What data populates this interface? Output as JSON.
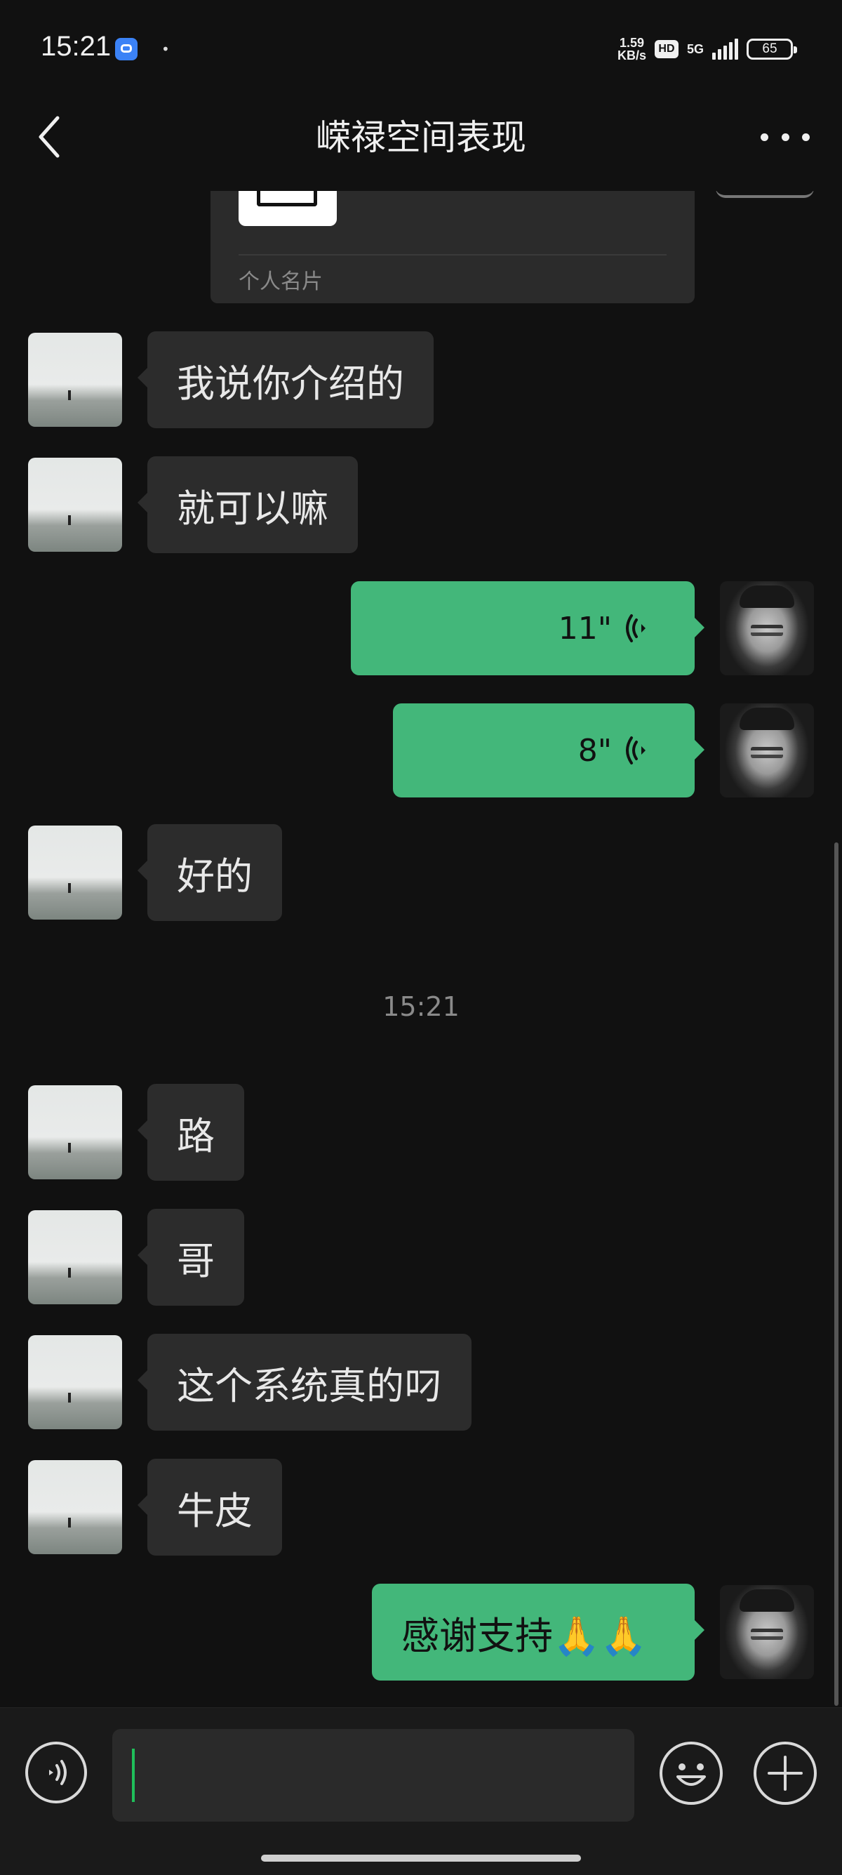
{
  "status_bar": {
    "time": "15:21",
    "net_speed_value": "1.59",
    "net_speed_unit": "KB/s",
    "hd_badge": "HD",
    "network": "5G",
    "battery": "65",
    "app_icon": "baidu-netdisk-icon"
  },
  "nav": {
    "title": "嵘禄空间表现",
    "back_icon": "chevron-left-icon",
    "more_icon": "ellipsis-icon"
  },
  "contact_card": {
    "label": "个人名片"
  },
  "messages": [
    {
      "side": "left",
      "text": "我说你介绍的"
    },
    {
      "side": "left",
      "text": "就可以嘛"
    },
    {
      "side": "right",
      "type": "voice",
      "duration": "11\""
    },
    {
      "side": "right",
      "type": "voice",
      "duration": "8\""
    },
    {
      "side": "left",
      "text": "好的"
    },
    {
      "type": "timestamp",
      "text": "15:21"
    },
    {
      "side": "left",
      "text": "路"
    },
    {
      "side": "left",
      "text": "哥"
    },
    {
      "side": "left",
      "text": "这个系统真的叼"
    },
    {
      "side": "left",
      "text": "牛皮"
    },
    {
      "side": "right",
      "text": "感谢支持🙏🙏"
    }
  ],
  "input_bar": {
    "value": "",
    "voice_icon": "voice-input-icon",
    "emoji_icon": "smiley-icon",
    "plus_icon": "plus-icon"
  },
  "colors": {
    "background": "#111111",
    "bubble_incoming": "#2c2c2c",
    "bubble_outgoing": "#43b77a",
    "cursor": "#1fbf5a"
  }
}
